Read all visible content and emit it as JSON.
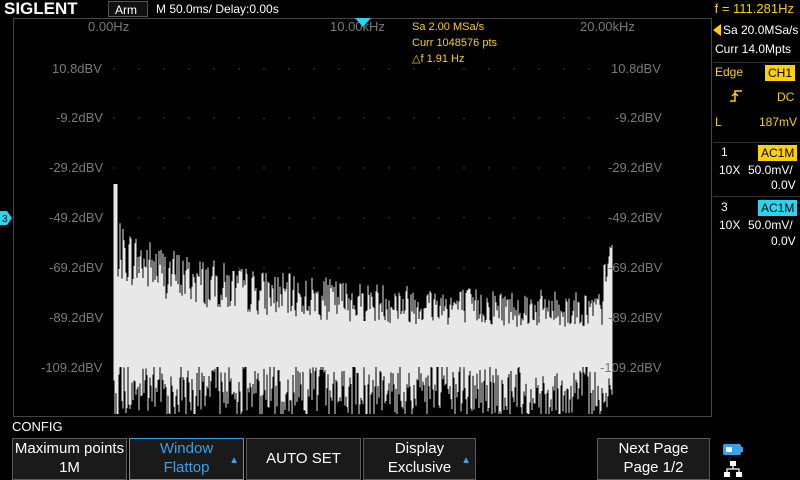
{
  "header": {
    "logo": "SIGLENT",
    "mode": "Arm",
    "timebase": "M 50.0ms/ Delay:0.00s",
    "frequency": "f = 111.281Hz"
  },
  "screen": {
    "x_labels": [
      "0.00Hz",
      "10.00kHz",
      "20.00kHz"
    ],
    "y_labels": [
      "10.8dBV",
      "-9.2dBV",
      "-29.2dBV",
      "-49.2dBV",
      "-69.2dBV",
      "-89.2dBV",
      "-109.2dBV"
    ],
    "info": {
      "sample_rate": "Sa 2.00 MSa/s",
      "curr_points": "Curr 1048576 pts",
      "delta_f": "△f 1.91 Hz"
    },
    "ch_marker": "3"
  },
  "right_panel": {
    "sample_rate": "Sa 20.0MSa/s",
    "memory": "Curr 14.0Mpts",
    "trigger": {
      "type": "Edge",
      "source": "CH1",
      "coupling": "DC",
      "level_label": "L",
      "level": "187mV"
    },
    "channels": [
      {
        "num": "1",
        "tag": "AC1M",
        "probe": "10X",
        "scale": "50.0mV/",
        "offset": "0.0V",
        "color": "#ffd000"
      },
      {
        "num": "3",
        "tag": "AC1M",
        "probe": "10X",
        "scale": "50.0mV/",
        "offset": "0.0V",
        "color": "#2ad4ee"
      }
    ]
  },
  "menu": {
    "title": "CONFIG",
    "softkeys": [
      {
        "line1": "Maximum points",
        "line2": "1M"
      },
      {
        "line1": "Window",
        "line2": "Flattop"
      },
      {
        "line1": "AUTO SET",
        "line2": ""
      },
      {
        "line1": "Display",
        "line2": "Exclusive"
      },
      {
        "line1": "",
        "line2": ""
      },
      {
        "line1": "Next Page",
        "line2": "Page 1/2"
      }
    ]
  },
  "colors": {
    "accent_yellow": "#ffd000",
    "accent_blue": "#3aa0e8",
    "ch3_cyan": "#2ad4ee"
  }
}
